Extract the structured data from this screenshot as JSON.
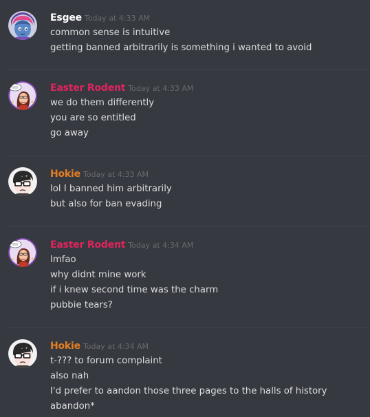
{
  "messages": [
    {
      "author": "Esgee",
      "author_color": "#ffffff",
      "avatar": "blue-haired-character-avatar",
      "timestamp": "Today at 4:33 AM",
      "lines": [
        "common sense is intuitive",
        "getting banned arbitrarily is something i wanted to avoid"
      ]
    },
    {
      "author": "Easter Rodent",
      "author_color": "#e0245e",
      "avatar": "comic-girl-avatar",
      "timestamp": "Today at 4:33 AM",
      "lines": [
        "we do them differently",
        "you are so entitled",
        "go away"
      ]
    },
    {
      "author": "Hokie",
      "author_color": "#e67e22",
      "avatar": "glasses-man-avatar",
      "timestamp": "Today at 4:33 AM",
      "lines": [
        "lol I banned him arbitrarily",
        "but also for ban evading"
      ]
    },
    {
      "author": "Easter Rodent",
      "author_color": "#e0245e",
      "avatar": "comic-girl-avatar",
      "timestamp": "Today at 4:34 AM",
      "lines": [
        "lmfao",
        "why didnt mine work",
        "if i knew second time was the charm",
        "pubbie tears?"
      ]
    },
    {
      "author": "Hokie",
      "author_color": "#e67e22",
      "avatar": "glasses-man-avatar",
      "timestamp": "Today at 4:34 AM",
      "lines": [
        "t-??? to forum complaint",
        "also nah",
        "I'd prefer to aandon those three pages to the halls of history",
        "abandon*"
      ]
    }
  ]
}
